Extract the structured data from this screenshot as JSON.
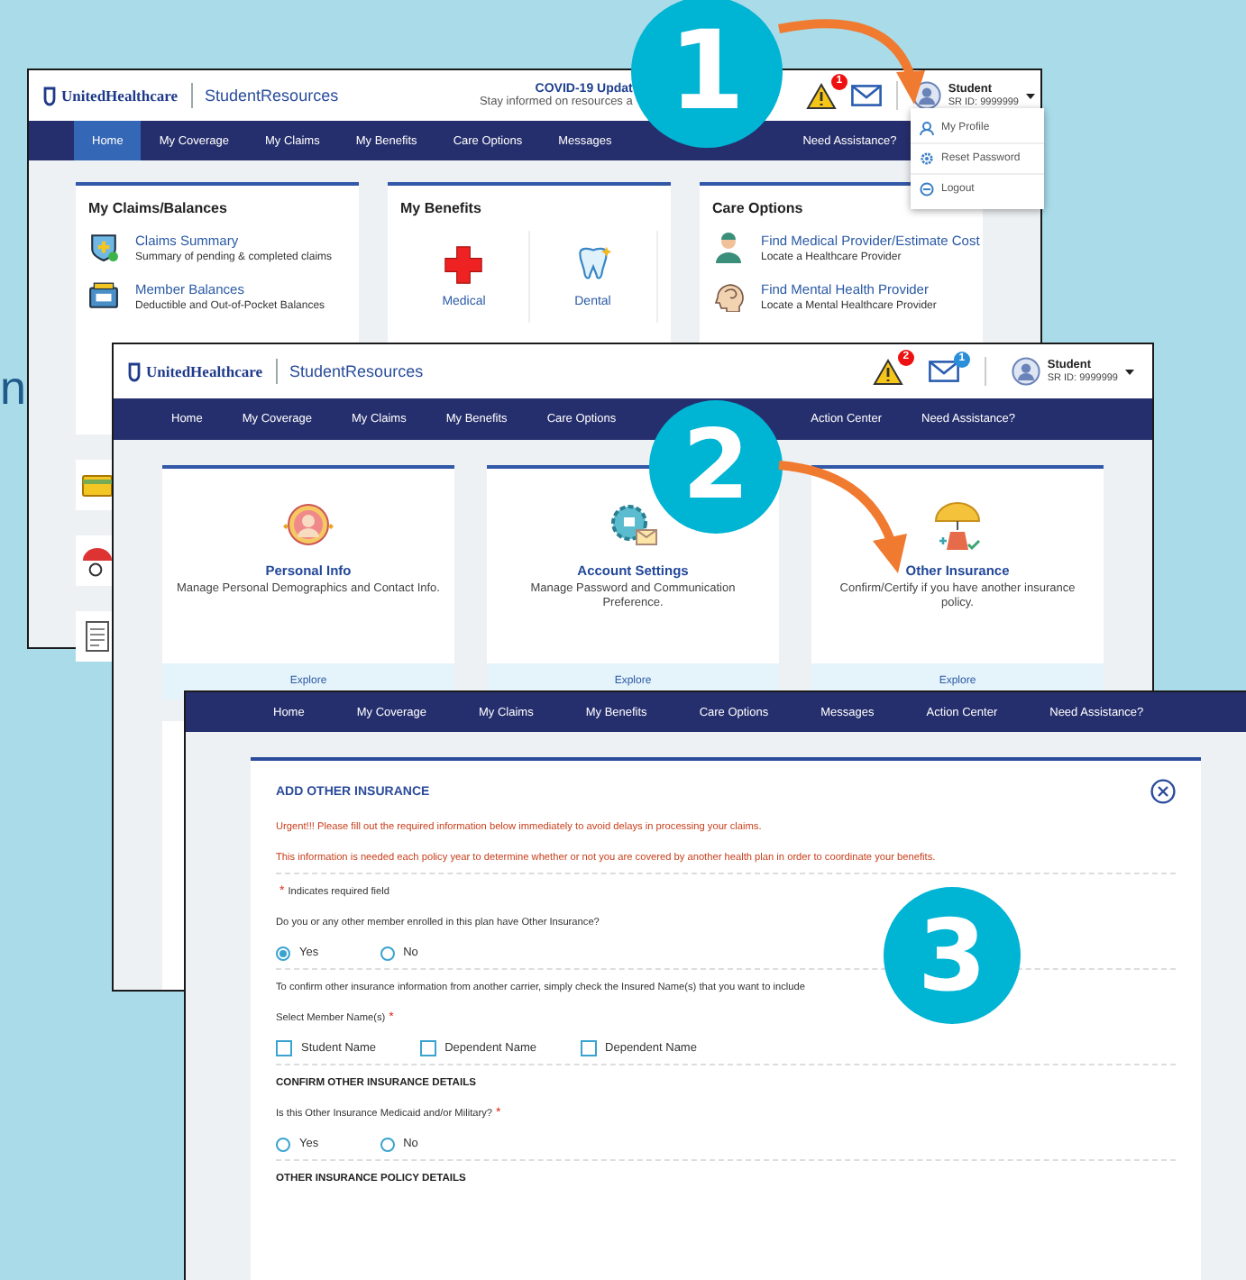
{
  "edge_text": "n",
  "home_window": {
    "header": {
      "brand": "UnitedHealthcare",
      "product": "StudentResources",
      "notice_title": "COVID-19 Updat",
      "notice_text": "Stay informed on resources a",
      "alert_count": "1",
      "user_name": "Student",
      "user_id": "SR ID: 9999999"
    },
    "nav": [
      {
        "label": "Home",
        "selected": true
      },
      {
        "label": "My Coverage",
        "selected": false
      },
      {
        "label": "My Claims",
        "selected": false
      },
      {
        "label": "My Benefits",
        "selected": false
      },
      {
        "label": "Care Options",
        "selected": false
      },
      {
        "label": "Messages",
        "selected": false
      },
      {
        "label": "Need Assistance?",
        "selected": false
      }
    ],
    "claims_card": {
      "title": "My Claims/Balances",
      "items": [
        {
          "title": "Claims Summary",
          "subtitle": "Summary of pending & completed claims"
        },
        {
          "title": "Member Balances",
          "subtitle": "Deductible and Out-of-Pocket Balances"
        }
      ]
    },
    "benefits_card": {
      "title": "My Benefits",
      "items": [
        {
          "label": "Medical"
        },
        {
          "label": "Dental"
        }
      ]
    },
    "care_card": {
      "title": "Care Options",
      "items": [
        {
          "title": "Find Medical Provider/Estimate Cost",
          "subtitle": "Locate a Healthcare Provider"
        },
        {
          "title": "Find Mental Health Provider",
          "subtitle": "Locate a Mental Healthcare Provider"
        }
      ]
    },
    "user_menu": [
      {
        "label": "My Profile"
      },
      {
        "label": "Reset Password"
      },
      {
        "label": "Logout"
      }
    ]
  },
  "profile_window": {
    "header": {
      "brand": "UnitedHealthcare",
      "product": "StudentResources",
      "alert_count": "2",
      "mail_count": "1",
      "user_name": "Student",
      "user_id": "SR ID: 9999999"
    },
    "nav": [
      {
        "label": "Home",
        "selected": false
      },
      {
        "label": "My Coverage",
        "selected": false
      },
      {
        "label": "My Claims",
        "selected": false
      },
      {
        "label": "My Benefits",
        "selected": false
      },
      {
        "label": "Care Options",
        "selected": false
      },
      {
        "label": "Action Center",
        "selected": false
      },
      {
        "label": "Need Assistance?",
        "selected": false
      }
    ],
    "cards": [
      {
        "title": "Personal Info",
        "description": "Manage Personal Demographics and Contact Info.",
        "link": "Explore"
      },
      {
        "title": "Account Settings",
        "description": "Manage Password and Communication Preference.",
        "link": "Explore"
      },
      {
        "title": "Other Insurance",
        "description": "Confirm/Certify if you have another insurance policy.",
        "link": "Explore"
      }
    ]
  },
  "insurance_window": {
    "nav": [
      {
        "label": "Home",
        "selected": false
      },
      {
        "label": "My Coverage",
        "selected": false
      },
      {
        "label": "My Claims",
        "selected": false
      },
      {
        "label": "My Benefits",
        "selected": false
      },
      {
        "label": "Care Options",
        "selected": false
      },
      {
        "label": "Messages",
        "selected": false
      },
      {
        "label": "Action Center",
        "selected": false
      },
      {
        "label": "Need Assistance?",
        "selected": false
      }
    ],
    "form": {
      "title": "ADD OTHER INSURANCE",
      "alerts": [
        "Urgent!!! Please fill out the required information below immediately to avoid delays in processing your claims.",
        "This information is needed each policy year to determine whether or not you are covered by another health plan in order to coordinate your benefits."
      ],
      "required_note": {
        "mark": "*",
        "text": "Indicates required field"
      },
      "other_insurance_question": {
        "label": "Do you or any other member enrolled in this plan have Other Insurance?",
        "options": [
          {
            "label": "Yes",
            "selected": true
          },
          {
            "label": "No",
            "selected": false
          }
        ]
      },
      "member_instructions": "To confirm other insurance information from another carrier, simply check the Insured Name(s) that you want to include",
      "member_select": {
        "label": "Select Member Name(s)",
        "required_mark": "*",
        "options": [
          {
            "label": "Student Name",
            "checked": false
          },
          {
            "label": "Dependent Name",
            "checked": false
          },
          {
            "label": "Dependent Name",
            "checked": false
          }
        ]
      },
      "confirm_section": {
        "heading": "CONFIRM OTHER INSURANCE DETAILS",
        "question": {
          "label": "Is this Other Insurance Medicaid and/or Military?",
          "required_mark": "*",
          "options": [
            {
              "label": "Yes",
              "selected": false
            },
            {
              "label": "No",
              "selected": false
            }
          ]
        }
      },
      "policy_section": {
        "heading": "OTHER INSURANCE POLICY DETAILS"
      }
    }
  },
  "steps": [
    {
      "number": "1"
    },
    {
      "number": "2"
    },
    {
      "number": "3"
    }
  ]
}
